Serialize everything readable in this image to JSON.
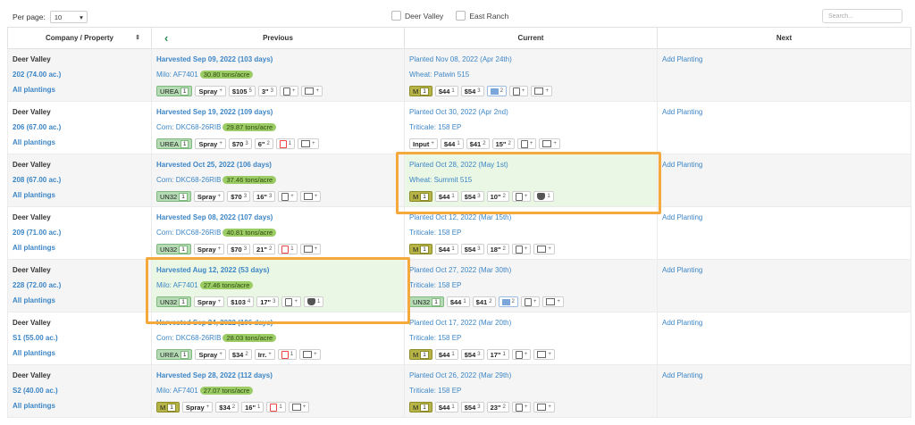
{
  "toolbar": {
    "per_page_label": "Per page:",
    "per_page_value": "10",
    "filters": [
      "Deer Valley",
      "East Ranch"
    ],
    "search_placeholder": "Search..."
  },
  "columns": {
    "company": "Company / Property",
    "previous": "Previous",
    "current": "Current",
    "next": "Next"
  },
  "rows": [
    {
      "company": "Deer Valley",
      "property": "202 (74.00 ac.)",
      "all": "All plantings",
      "prev": {
        "title": "Harvested Sep 09, 2022 (103 days)",
        "crop": "Milo: AF7401",
        "tons": "30.80 tons/acre",
        "chips": [
          [
            "g",
            "UREA",
            "1"
          ],
          [
            "n",
            "Spray",
            "+"
          ],
          [
            "n",
            "$105",
            "5"
          ],
          [
            "n",
            "3\"",
            "3"
          ],
          [
            "pdf",
            "",
            "+"
          ],
          [
            "map",
            "",
            "+"
          ]
        ]
      },
      "cur": {
        "title": "Planted Nov 08, 2022 (Apr 24th)",
        "crop": "Wheat: Patwin 515",
        "chips": [
          [
            "m",
            "M",
            "1"
          ],
          [
            "n",
            "$44",
            "1"
          ],
          [
            "n",
            "$54",
            "3"
          ],
          [
            "bl",
            "",
            "2"
          ],
          [
            "pdf",
            "",
            "+"
          ],
          [
            "map",
            "",
            "+"
          ]
        ]
      },
      "next": "Add Planting"
    },
    {
      "company": "Deer Valley",
      "property": "206 (67.00 ac.)",
      "all": "All plantings",
      "prev": {
        "title": "Harvested Sep 19, 2022 (109 days)",
        "crop": "Corn: DKC68-26RIB",
        "tons": "29.87 tons/acre",
        "chips": [
          [
            "g",
            "UREA",
            "1"
          ],
          [
            "n",
            "Spray",
            "+"
          ],
          [
            "n",
            "$70",
            "3"
          ],
          [
            "n",
            "6\"",
            "2"
          ],
          [
            "redpdf",
            "",
            "1"
          ],
          [
            "map",
            "",
            "+"
          ]
        ]
      },
      "cur": {
        "title": "Planted Oct 30, 2022 (Apr 2nd)",
        "crop": "Triticale: 158 EP",
        "chips": [
          [
            "n",
            "Input",
            "+"
          ],
          [
            "n",
            "$44",
            "1"
          ],
          [
            "n",
            "$41",
            "2"
          ],
          [
            "n",
            "15\"",
            "2"
          ],
          [
            "pdf",
            "",
            "+"
          ],
          [
            "map",
            "",
            "+"
          ]
        ]
      },
      "next": "Add Planting"
    },
    {
      "company": "Deer Valley",
      "property": "208 (67.00 ac.)",
      "all": "All plantings",
      "prev": {
        "title": "Harvested Oct 25, 2022 (106 days)",
        "crop": "Corn: DKC68-26RIB",
        "tons": "37.46 tons/acre",
        "chips": [
          [
            "g",
            "UN32",
            "1"
          ],
          [
            "n",
            "Spray",
            "+"
          ],
          [
            "n",
            "$70",
            "3"
          ],
          [
            "n",
            "16\"",
            "3"
          ],
          [
            "pdf",
            "",
            "+"
          ],
          [
            "map",
            "",
            "+"
          ]
        ]
      },
      "cur": {
        "title": "Planted Oct 28, 2022 (May 1st)",
        "crop": "Wheat: Summit 515",
        "chips": [
          [
            "m",
            "M",
            "1"
          ],
          [
            "n",
            "$44",
            "1"
          ],
          [
            "n",
            "$54",
            "3"
          ],
          [
            "n",
            "10\"",
            "2"
          ],
          [
            "pdf",
            "",
            "+"
          ],
          [
            "tractor",
            "",
            "1"
          ]
        ]
      },
      "next": "Add Planting"
    },
    {
      "company": "Deer Valley",
      "property": "209 (71.00 ac.)",
      "all": "All plantings",
      "prev": {
        "title": "Harvested Sep 08, 2022 (107 days)",
        "crop": "Corn: DKC68-26RIB",
        "tons": "40.81 tons/acre",
        "chips": [
          [
            "g",
            "UN32",
            "1"
          ],
          [
            "n",
            "Spray",
            "+"
          ],
          [
            "n",
            "$70",
            "3"
          ],
          [
            "n",
            "21\"",
            "2"
          ],
          [
            "redpdf",
            "",
            "1"
          ],
          [
            "map",
            "",
            "+"
          ]
        ]
      },
      "cur": {
        "title": "Planted Oct 12, 2022 (Mar 15th)",
        "crop": "Triticale: 158 EP",
        "chips": [
          [
            "m",
            "M",
            "1"
          ],
          [
            "n",
            "$44",
            "1"
          ],
          [
            "n",
            "$54",
            "3"
          ],
          [
            "n",
            "18\"",
            "2"
          ],
          [
            "pdf",
            "",
            "+"
          ],
          [
            "map",
            "",
            "+"
          ]
        ]
      },
      "next": "Add Planting"
    },
    {
      "company": "Deer Valley",
      "property": "228 (72.00 ac.)",
      "all": "All plantings",
      "prev": {
        "title": "Harvested Aug 12, 2022 (53 days)",
        "crop": "Milo: AF7401",
        "tons": "27.46 tons/acre",
        "chips": [
          [
            "g",
            "UN32",
            "1"
          ],
          [
            "n",
            "Spray",
            "+"
          ],
          [
            "n",
            "$103",
            "4"
          ],
          [
            "n",
            "17\"",
            "3"
          ],
          [
            "pdf",
            "",
            "+"
          ],
          [
            "tractor",
            "",
            "1"
          ]
        ]
      },
      "cur": {
        "title": "Planted Oct 27, 2022 (Mar 30th)",
        "crop": "Triticale: 158 EP",
        "chips": [
          [
            "g",
            "UN32",
            "1"
          ],
          [
            "n",
            "$44",
            "1"
          ],
          [
            "n",
            "$41",
            "2"
          ],
          [
            "bl",
            "",
            "2"
          ],
          [
            "pdf",
            "",
            "+"
          ],
          [
            "map",
            "",
            "+"
          ]
        ]
      },
      "next": "Add Planting"
    },
    {
      "company": "Deer Valley",
      "property": "S1 (55.00 ac.)",
      "all": "All plantings",
      "prev": {
        "title": "Harvested Sep 24, 2022 (106 days)",
        "crop": "Corn: DKC68-26RIB",
        "tons": "28.03 tons/acre",
        "chips": [
          [
            "g",
            "UREA",
            "1"
          ],
          [
            "n",
            "Spray",
            "+"
          ],
          [
            "n",
            "$34",
            "2"
          ],
          [
            "n",
            "Irr.",
            "+"
          ],
          [
            "redpdf",
            "",
            "1"
          ],
          [
            "map",
            "",
            "+"
          ]
        ]
      },
      "cur": {
        "title": "Planted Oct 17, 2022 (Mar 20th)",
        "crop": "Triticale: 158 EP",
        "chips": [
          [
            "m",
            "M",
            "1"
          ],
          [
            "n",
            "$44",
            "1"
          ],
          [
            "n",
            "$54",
            "3"
          ],
          [
            "n",
            "17\"",
            "1"
          ],
          [
            "pdf",
            "",
            "+"
          ],
          [
            "map",
            "",
            "+"
          ]
        ]
      },
      "next": "Add Planting"
    },
    {
      "company": "Deer Valley",
      "property": "S2 (40.00 ac.)",
      "all": "All plantings",
      "prev": {
        "title": "Harvested Sep 28, 2022 (112 days)",
        "crop": "Milo: AF7401",
        "tons": "27.07 tons/acre",
        "chips": [
          [
            "m",
            "M",
            "1"
          ],
          [
            "n",
            "Spray",
            "+"
          ],
          [
            "n",
            "$34",
            "2"
          ],
          [
            "n",
            "16\"",
            "1"
          ],
          [
            "redpdf",
            "",
            "1"
          ],
          [
            "map",
            "",
            "+"
          ]
        ]
      },
      "cur": {
        "title": "Planted Oct 26, 2022 (Mar 29th)",
        "crop": "Triticale: 158 EP",
        "chips": [
          [
            "m",
            "M",
            "1"
          ],
          [
            "n",
            "$44",
            "1"
          ],
          [
            "n",
            "$54",
            "3"
          ],
          [
            "n",
            "23\"",
            "2"
          ],
          [
            "pdf",
            "",
            "+"
          ],
          [
            "map",
            "",
            "+"
          ]
        ]
      },
      "next": "Add Planting"
    }
  ],
  "colors": {
    "link": "#3d86c6",
    "highlight_bg": "#eaf7e4",
    "highlight_border": "#f5a83c",
    "tons_bg": "#9ccc65",
    "green_chip": "#b5dbb4",
    "olive_chip": "#b6b446"
  }
}
